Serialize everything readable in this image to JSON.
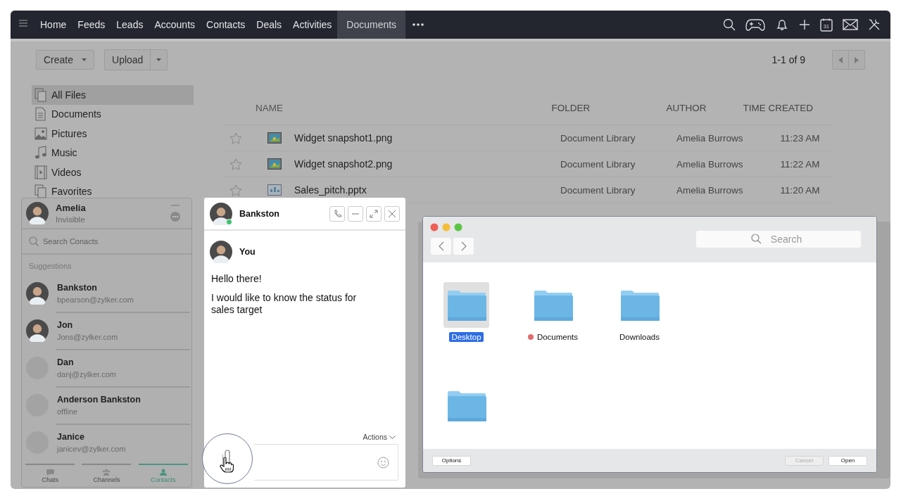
{
  "nav": {
    "items": [
      {
        "label": "Home",
        "selected": false
      },
      {
        "label": "Feeds",
        "selected": false
      },
      {
        "label": "Leads",
        "selected": false
      },
      {
        "label": "Accounts",
        "selected": false
      },
      {
        "label": "Contacts",
        "selected": false
      },
      {
        "label": "Deals",
        "selected": false
      },
      {
        "label": "Activities",
        "selected": false
      },
      {
        "label": "Documents",
        "selected": true
      }
    ],
    "calendar_day": "31"
  },
  "toolbar": {
    "create": "Create",
    "upload": "Upload",
    "pagination": "1-1 of 9"
  },
  "sidebar": {
    "items": [
      {
        "label": "All Files",
        "kind": "files",
        "selected": true
      },
      {
        "label": "Documents",
        "kind": "doc",
        "selected": false
      },
      {
        "label": "Pictures",
        "kind": "picture",
        "selected": false
      },
      {
        "label": "Music",
        "kind": "music",
        "selected": false
      },
      {
        "label": "Videos",
        "kind": "video",
        "selected": false
      },
      {
        "label": "Favorites",
        "kind": "files",
        "selected": false
      }
    ]
  },
  "table": {
    "columns": [
      "NAME",
      "FOLDER",
      "AUTHOR",
      "TIME CREATED"
    ],
    "rows": [
      {
        "starred": false,
        "kind": "image",
        "name": "Widget snapshot1.png",
        "folder": "Document Library",
        "author": "Amelia Burrows",
        "time": "11:23 AM"
      },
      {
        "starred": false,
        "kind": "image",
        "name": "Widget snapshot2.png",
        "folder": "Document Library",
        "author": "Amelia Burrows",
        "time": "11:22 AM"
      },
      {
        "starred": false,
        "kind": "slides",
        "name": "Sales_pitch.pptx",
        "folder": "Document Library",
        "author": "Amelia Burrows",
        "time": "11:20 AM"
      }
    ]
  },
  "contacts_panel": {
    "user": {
      "name": "Amelia",
      "status": "Invisible"
    },
    "search": {
      "placeholder": "Search Conacts"
    },
    "section": "Suggestions",
    "contacts": [
      {
        "name": "Bankston",
        "detail": "bpearson@zylker.com",
        "kind": "figure"
      },
      {
        "name": "Jon",
        "detail": "Jons@zylker.com",
        "kind": "figure"
      },
      {
        "name": "Dan",
        "detail": "danj@zylker.com",
        "kind": "blank"
      },
      {
        "name": "Anderson Bankston",
        "detail": "offline",
        "kind": "blank"
      },
      {
        "name": "Janice",
        "detail": "janicev@zylker.com",
        "kind": "blank"
      }
    ],
    "tabs": [
      {
        "label": "Chats",
        "kind": "chats",
        "selected": false
      },
      {
        "label": "Channels",
        "kind": "channels",
        "selected": false
      },
      {
        "label": "Contacts",
        "kind": "contacts",
        "selected": true
      }
    ]
  },
  "chat": {
    "title": "Bankston",
    "online": true,
    "message": {
      "sender": "You",
      "lines": [
        "Hello there!",
        "I would like to know the status for sales target"
      ]
    },
    "actions": "Actions"
  },
  "dialog": {
    "search": {
      "placeholder": "Search"
    },
    "folders": [
      {
        "label": "Desktop",
        "selected": true
      },
      {
        "label": "Documents",
        "selected": false,
        "color": "#e06c6c"
      },
      {
        "label": "Downloads",
        "selected": false
      },
      {
        "selected": false
      }
    ],
    "buttons": [
      {
        "label": "Options",
        "disabled": false
      },
      {
        "label": "Cancel",
        "disabled": true
      },
      {
        "label": "Open",
        "disabled": false
      }
    ]
  }
}
